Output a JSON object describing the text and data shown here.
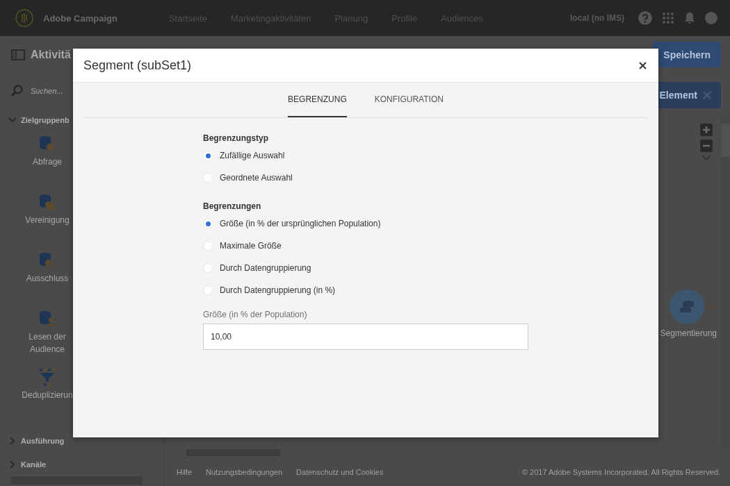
{
  "header": {
    "brand": "Adobe Campaign",
    "nav": [
      "Startseite",
      "Marketingaktivitäten",
      "Planung",
      "Profile",
      "Audiences"
    ],
    "user": "local (no IMS)"
  },
  "toolbar": {
    "title": "Aktivitä",
    "save_button": "Speichern"
  },
  "sidebar": {
    "search": {
      "placeholder": "Suchen..."
    },
    "sections": [
      {
        "label": "Zielgruppenb",
        "expanded": true,
        "items": [
          {
            "label": "Abfrage",
            "kind": "query"
          },
          {
            "label": "Vereinigung",
            "kind": "union"
          },
          {
            "label": "Ausschluss",
            "kind": "exclusion"
          },
          {
            "label": "Lesen der Audience",
            "kind": "audience"
          },
          {
            "label": "Deduplizierun",
            "kind": "dedup"
          }
        ]
      },
      {
        "label": "Ausführung",
        "expanded": false
      },
      {
        "label": "Kanäle",
        "expanded": false
      }
    ]
  },
  "canvas": {
    "element_button": "Element",
    "node": {
      "label": "Segmentierung"
    }
  },
  "footer": {
    "links": [
      "Hilfe",
      "Nutzungsbedingungen",
      "Datenschutz und Cookies"
    ],
    "copyright": "© 2017 Adobe Systems Incorporated. All Rights Reserved."
  },
  "dialog": {
    "title": "Segment (subSet1)",
    "tabs": [
      {
        "label": "BEGRENZUNG",
        "selected": true
      },
      {
        "label": "KONFIGURATION",
        "selected": false
      }
    ],
    "groups": [
      {
        "label": "Begrenzungstyp",
        "options": [
          {
            "label": "Zufällige Auswahl",
            "selected": true
          },
          {
            "label": "Geordnete Auswahl",
            "selected": false
          }
        ]
      },
      {
        "label": "Begrenzungen",
        "options": [
          {
            "label": "Größe (in % der ursprünglichen Population)",
            "selected": true
          },
          {
            "label": "Maximale Größe",
            "selected": false
          },
          {
            "label": "Durch Datengruppierung",
            "selected": false
          },
          {
            "label": "Durch Datengruppierung (in %)",
            "selected": false
          }
        ]
      }
    ],
    "field": {
      "label": "Größe (in % der Population)",
      "value": "10,00"
    }
  }
}
